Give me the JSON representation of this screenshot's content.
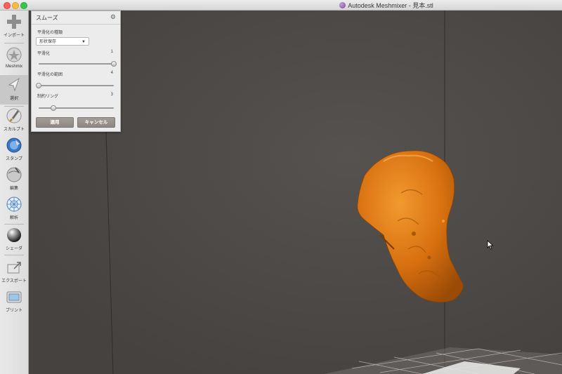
{
  "window": {
    "title": "Autodesk Meshmixer - 見本.stl"
  },
  "toolbar": {
    "items": [
      {
        "label": "インポート",
        "icon": "plus-icon"
      },
      {
        "label": "Meshmix",
        "icon": "meshmix-icon"
      },
      {
        "label": "選択",
        "icon": "select-arrow-icon",
        "active": true
      },
      {
        "label": "スカルプト",
        "icon": "brush-icon"
      },
      {
        "label": "スタンプ",
        "icon": "stamp-icon"
      },
      {
        "label": "編集",
        "icon": "edit-sphere-icon"
      },
      {
        "label": "解析",
        "icon": "analysis-sphere-icon"
      },
      {
        "label": "シェーダ",
        "icon": "shader-sphere-icon"
      },
      {
        "label": "エクスポート",
        "icon": "export-icon"
      },
      {
        "label": "プリント",
        "icon": "printer-icon"
      }
    ]
  },
  "panel": {
    "title": "スムーズ",
    "smoothing_type_label": "平滑化の種類",
    "smoothing_type_value": "形状保存",
    "smoothing_label": "平滑化",
    "smoothing_value": "1",
    "smoothing_level": 1.0,
    "range_label": "平滑化の範囲",
    "range_value": "4",
    "range_level": 0.0,
    "ring_label": "制約リング",
    "ring_value": "3",
    "ring_level": 0.2,
    "apply_button": "適用",
    "cancel_button": "キャンセル"
  },
  "colors": {
    "model": "#d87010",
    "background": "#4a4744",
    "panel": "#ececec"
  }
}
